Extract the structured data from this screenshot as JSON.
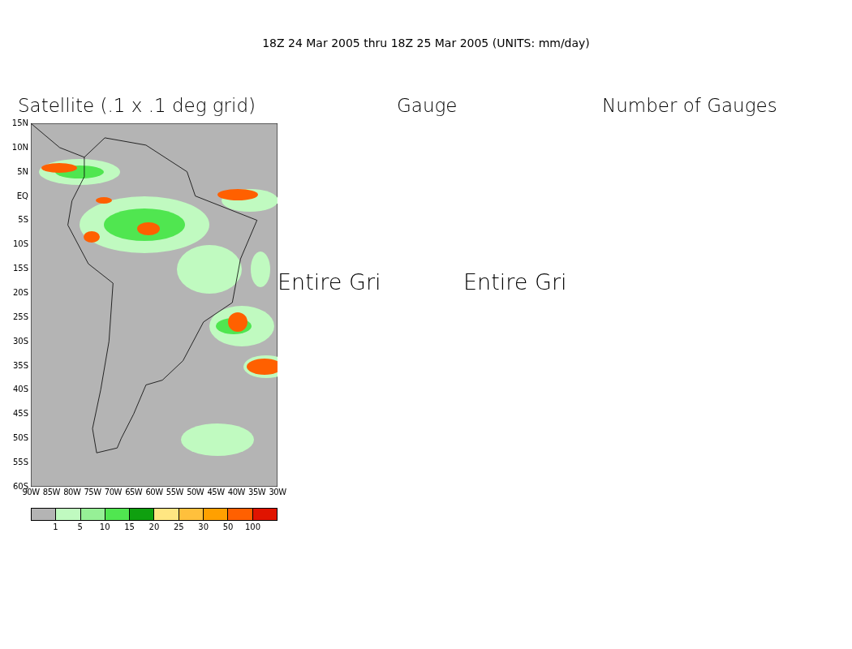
{
  "title": "18Z 24 Mar 2005 thru 18Z 25 Mar 2005 (UNITS: mm/day)",
  "panels": [
    {
      "kind": "map",
      "title": "Satellite (.1 x .1 deg grid)",
      "lat_labels": [
        "15N",
        "10N",
        "5N",
        "EQ",
        "5S",
        "10S",
        "15S",
        "20S",
        "25S",
        "30S",
        "35S",
        "40S",
        "45S",
        "50S",
        "55S",
        "60S"
      ],
      "lon_labels": [
        "90W",
        "85W",
        "80W",
        "75W",
        "70W",
        "65W",
        "60W",
        "55W",
        "50W",
        "45W",
        "40W",
        "35W",
        "30W"
      ]
    },
    {
      "kind": "message",
      "title": "Gauge",
      "message": "Entire Gri"
    },
    {
      "kind": "message",
      "title": "Number of Gauges",
      "message": "Entire Gri"
    }
  ],
  "legend": {
    "colors": [
      {
        "color": "#b4b4b4"
      },
      {
        "color": "#c0fac0"
      },
      {
        "color": "#96f096"
      },
      {
        "color": "#50e650"
      },
      {
        "color": "#0fa00f"
      },
      {
        "color": "#ffe682"
      },
      {
        "color": "#ffc03c"
      },
      {
        "color": "#ffa000"
      },
      {
        "color": "#ff6000"
      },
      {
        "color": "#e01400"
      }
    ],
    "labels": [
      "1",
      "5",
      "10",
      "15",
      "20",
      "25",
      "30",
      "50",
      "100"
    ]
  }
}
